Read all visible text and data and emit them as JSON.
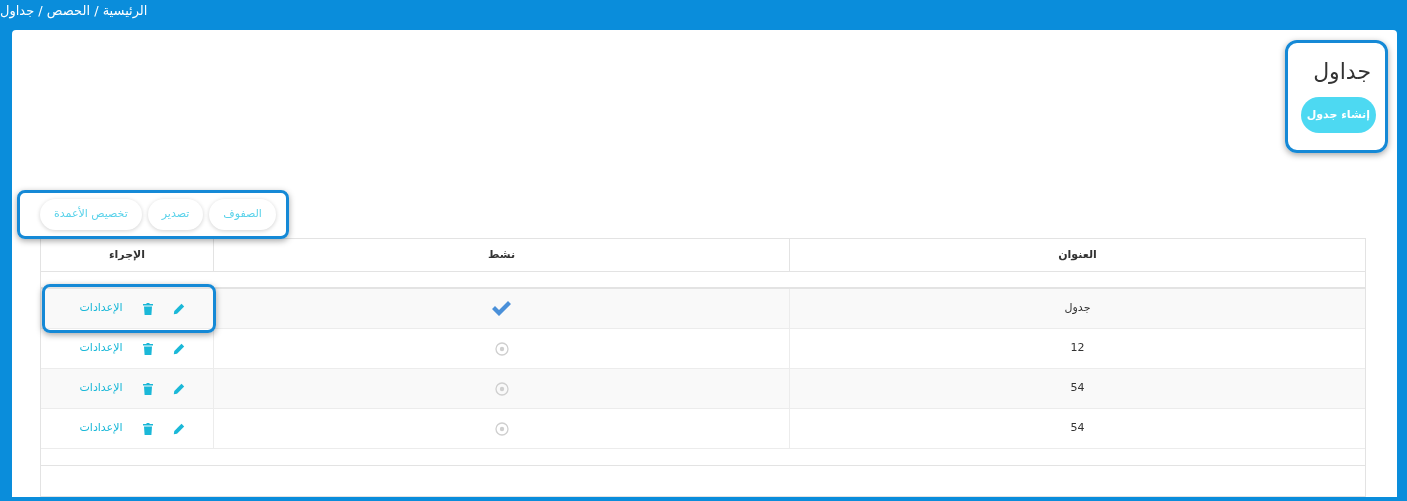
{
  "breadcrumb": "الرئيسية / الحصص / جداول",
  "page": {
    "title": "جداول",
    "create_button": "إنشاء جدول"
  },
  "toolbar": [
    "الصفوف",
    "تصدير",
    "تخصيص الأعمدة"
  ],
  "table": {
    "columns": [
      "العنوان",
      "نشط",
      "الإجراء"
    ],
    "rows": [
      {
        "title": "جدول",
        "active": true,
        "action": "الإعدادات"
      },
      {
        "title": "12",
        "active": false,
        "action": "الإعدادات"
      },
      {
        "title": "54",
        "active": false,
        "action": "الإعدادات"
      },
      {
        "title": "54",
        "active": false,
        "action": "الإعدادات"
      }
    ]
  }
}
